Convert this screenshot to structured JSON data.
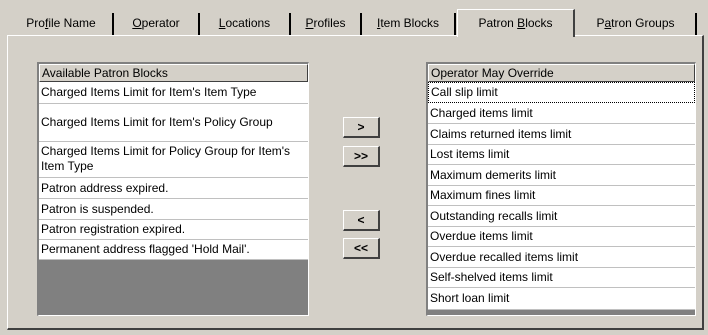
{
  "tabs": [
    {
      "pre": "Pro",
      "u": "f",
      "post": "ile Name"
    },
    {
      "pre": "",
      "u": "O",
      "post": "perator"
    },
    {
      "pre": "",
      "u": "L",
      "post": "ocations"
    },
    {
      "pre": "",
      "u": "P",
      "post": "rofiles"
    },
    {
      "pre": "",
      "u": "I",
      "post": "tem Blocks"
    },
    {
      "pre": "Patron ",
      "u": "B",
      "post": "locks"
    },
    {
      "pre": "P",
      "u": "a",
      "post": "tron Groups"
    }
  ],
  "active_tab_index": 5,
  "available": {
    "header": "Available Patron Blocks",
    "items": [
      "Charged Items Limit for Item's Item Type",
      "Charged Items Limit for Item's Policy Group",
      "Charged Items Limit for Policy Group for Item's Item Type",
      "Patron address expired.",
      "Patron is suspended.",
      "Patron registration expired.",
      "Permanent address flagged 'Hold Mail'."
    ]
  },
  "buttons": {
    "add": ">",
    "add_all": ">>",
    "remove": "<",
    "remove_all": "<<"
  },
  "override": {
    "header": "Operator May Override",
    "items": [
      "Call slip limit",
      "Charged items limit",
      "Claims returned items limit",
      "Lost items limit",
      "Maximum demerits limit",
      "Maximum fines limit",
      "Outstanding recalls limit",
      "Overdue items limit",
      "Overdue recalled items limit",
      "Self-shelved items limit",
      "Short loan limit"
    ],
    "focused_index": 0
  }
}
